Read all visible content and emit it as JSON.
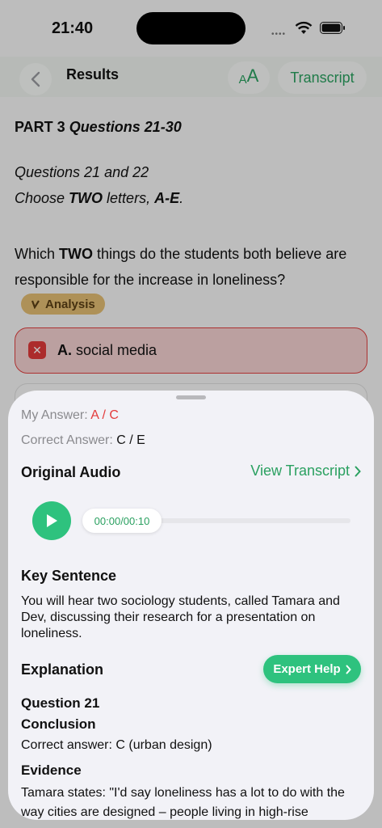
{
  "status": {
    "time": "21:40",
    "signal": "••••"
  },
  "nav": {
    "title": "Results",
    "font_small": "A",
    "font_big": "A",
    "transcript": "Transcript"
  },
  "content": {
    "part_prefix": "PART 3 ",
    "part_italic": "Questions 21-30",
    "q_line1": "Questions 21 and 22",
    "q_line2_a": "Choose ",
    "q_line2_b": "TWO",
    "q_line2_c": " letters, ",
    "q_line2_d": "A-E",
    "q_line2_e": ".",
    "question_a": "Which ",
    "question_b": "TWO",
    "question_c": " things do the students both believe are responsible for the increase in loneliness?",
    "analysis_label": "Analysis",
    "option_a_letter": "A.",
    "option_a_text": " social media"
  },
  "sheet": {
    "my_answer_label": "My Answer: ",
    "my_answer_value": "A / C",
    "correct_answer_label": "Correct Answer: ",
    "correct_answer_value": "C / E",
    "original_audio": "Original Audio",
    "view_transcript": "View Transcript",
    "audio_time": "00:00/00:10",
    "audio_progress": 0,
    "key_sentence_title": "Key Sentence",
    "key_sentence": "You will hear two sociology students, called Tamara and Dev, discussing their research for a presentation on loneliness.",
    "explanation_title": "Explanation",
    "expert_help": "Expert Help",
    "question_21": "Question 21",
    "conclusion": "Conclusion",
    "correct_answer_text": "Correct answer: C (urban design)",
    "evidence": "Evidence",
    "evidence_text": "Tamara states: \"I'd say loneliness has a lot to do with the way cities are designed – people living in high-rise"
  },
  "colors": {
    "accent": "#2ec27e",
    "error": "#e33b3b",
    "analysis": "#e3bd73"
  }
}
